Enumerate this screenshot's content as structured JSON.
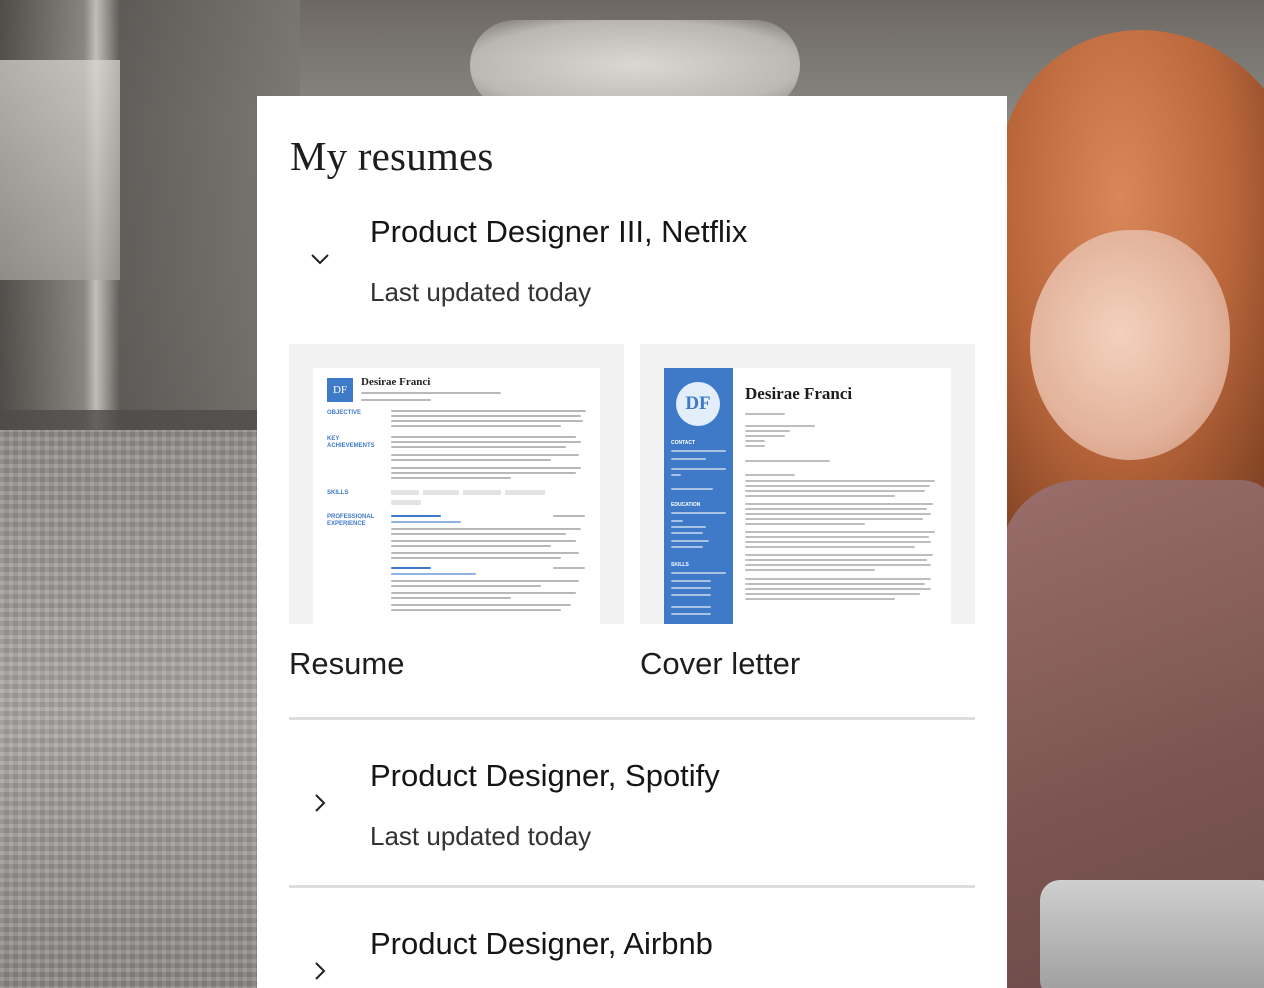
{
  "page": {
    "title": "My resumes"
  },
  "resumes": [
    {
      "title": "Product Designer III, Netflix",
      "subtitle": "Last updated today",
      "expanded": true,
      "chevron": "chevron-down-icon",
      "documents": [
        {
          "label": "Resume",
          "preview": {
            "name": "Desirae Franci",
            "monogram": "DF",
            "sections": [
              "OBJECTIVE",
              "KEY ACHIEVEMENTS",
              "SKILLS",
              "PROFESSIONAL EXPERIENCE"
            ]
          }
        },
        {
          "label": "Cover letter",
          "preview": {
            "name": "Desirae Franci",
            "monogram": "DF",
            "sidebar_sections": [
              "CONTACT",
              "EDUCATION",
              "SKILLS"
            ]
          }
        }
      ]
    },
    {
      "title": "Product Designer, Spotify",
      "subtitle": "Last updated today",
      "expanded": false,
      "chevron": "chevron-right-icon"
    },
    {
      "title": "Product Designer, Airbnb",
      "expanded": false,
      "chevron": "chevron-right-icon"
    }
  ],
  "colors": {
    "accent": "#3f7ac9",
    "card": "#ffffff",
    "divider": "#dcdcdc"
  }
}
